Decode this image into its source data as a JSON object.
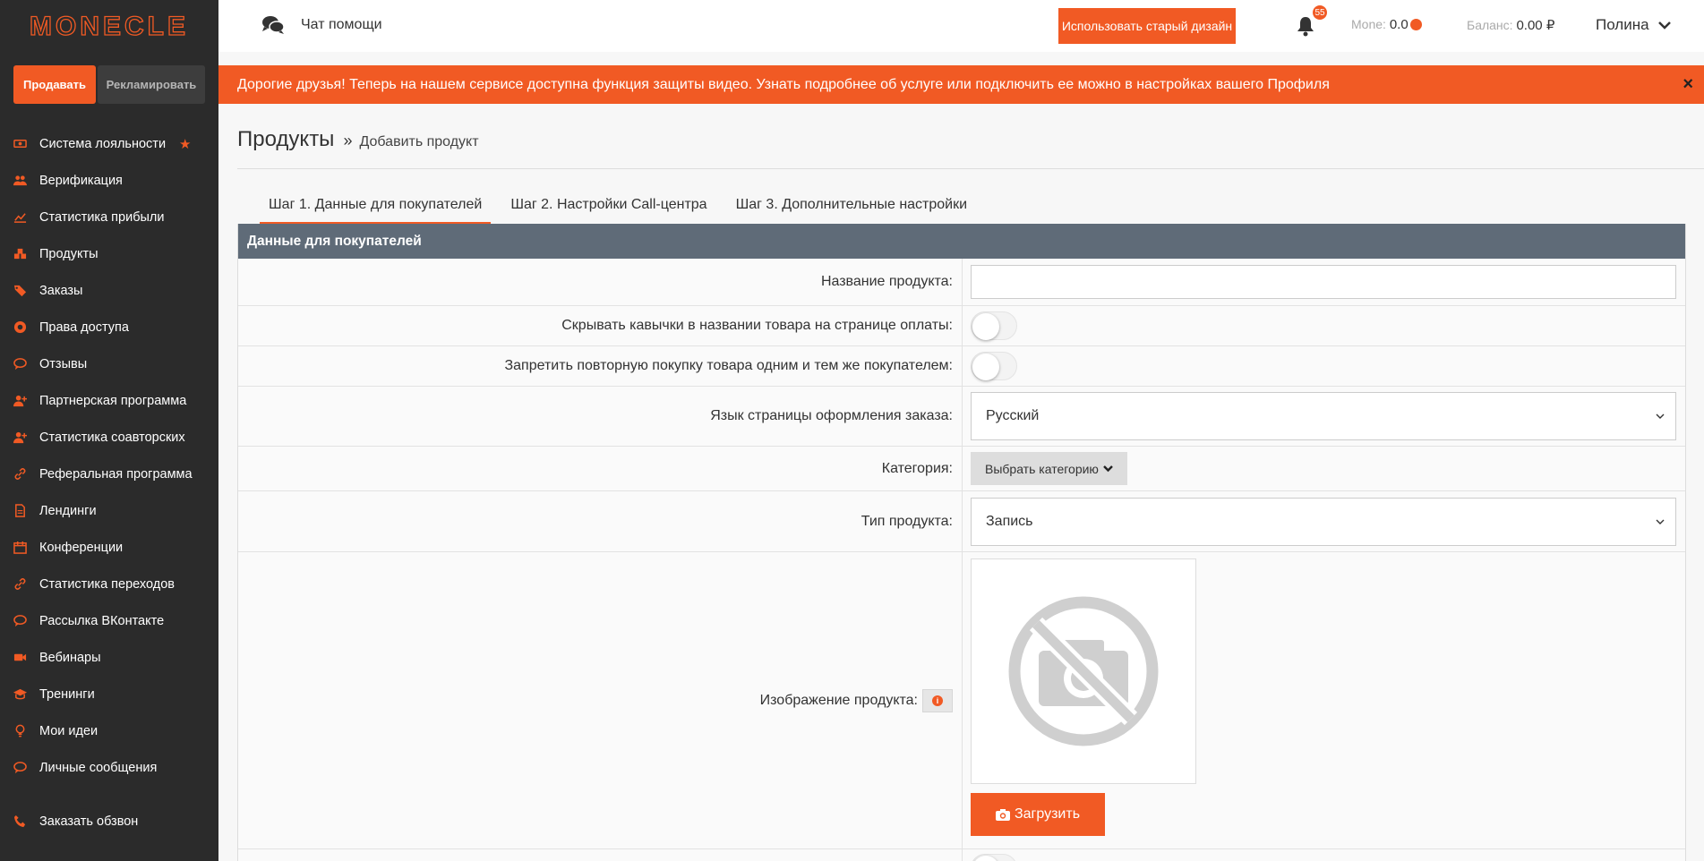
{
  "logo": "MONECLE",
  "sidebar": {
    "sell_label": "Продавать",
    "advertise_label": "Рекламировать",
    "items": [
      {
        "label": "Система лояльности",
        "icon": "money-icon"
      },
      {
        "label": "Верификация",
        "icon": "users-icon"
      },
      {
        "label": "Статистика прибыли",
        "icon": "line-chart-icon"
      },
      {
        "label": "Продукты",
        "icon": "cubes-icon"
      },
      {
        "label": "Заказы",
        "icon": "tags-icon"
      },
      {
        "label": "Права доступа",
        "icon": "globe-icon"
      },
      {
        "label": "Отзывы",
        "icon": "comments-icon"
      },
      {
        "label": "Партнерская программа",
        "icon": "user-plus-icon"
      },
      {
        "label": "Статистика соавторских",
        "icon": "user-plus-icon"
      },
      {
        "label": "Реферальная программа",
        "icon": "link-icon"
      },
      {
        "label": "Лендинги",
        "icon": "file-icon"
      },
      {
        "label": "Конференции",
        "icon": "calendar-icon"
      },
      {
        "label": "Статистика переходов",
        "icon": "link-icon"
      },
      {
        "label": "Рассылка ВКонтакте",
        "icon": "comments-icon"
      },
      {
        "label": "Вебинары",
        "icon": "video-icon"
      },
      {
        "label": "Тренинги",
        "icon": "graduation-cap-icon"
      },
      {
        "label": "Мои идеи",
        "icon": "lightbulb-icon"
      },
      {
        "label": "Личные сообщения",
        "icon": "comments-icon"
      }
    ],
    "bottom_item": {
      "label": "Заказать обзвон",
      "icon": "phone-icon"
    }
  },
  "topbar": {
    "chat_label": "Чат помощи",
    "old_design_label": "Использовать старый дизайн",
    "notifications_count": "55",
    "monne_label": "Monе:",
    "monne_value": "0.0",
    "balance_label": "Баланс:",
    "balance_value": "0.00 ₽",
    "user_name": "Полина"
  },
  "banner": {
    "text": "Дорогие друзья! Теперь на нашем сервисе доступна функция защиты видео. Узнать подробнее об услуге или подключить ее можно в настройках вашего Профиля",
    "close": "×"
  },
  "page": {
    "title": "Продукты",
    "separator": "»",
    "breadcrumb": "Добавить продукт"
  },
  "tabs": [
    {
      "label": "Шаг 1. Данные для покупателей",
      "active": true
    },
    {
      "label": "Шаг 2. Настройки Call-центра",
      "active": false
    },
    {
      "label": "Шаг 3. Дополнительные настройки",
      "active": false
    }
  ],
  "form": {
    "section_title": "Данные для покупателей",
    "product_name_label": "Название продукта:",
    "product_name_value": "",
    "hide_quotes_label": "Скрывать кавычки в названии товара на странице оплаты:",
    "hide_quotes_on": false,
    "forbid_repeat_label": "Запретить повторную покупку товара одним и тем же покупателем:",
    "forbid_repeat_on": false,
    "language_label": "Язык страницы оформления заказа:",
    "language_value": "Русский",
    "category_label": "Категория:",
    "category_button": "Выбрать категорию",
    "type_label": "Тип продукта:",
    "type_value": "Запись",
    "image_label": "Изображение продукта:",
    "info_symbol": "i",
    "upload_label": "Загрузить"
  },
  "colors": {
    "accent": "#f15a24",
    "sidebar_bg": "#2b2b2b",
    "panel_header": "#5f6b78"
  }
}
